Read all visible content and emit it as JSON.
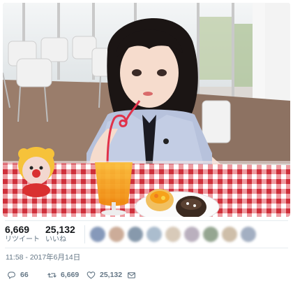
{
  "stats": {
    "retweets": {
      "count": "6,669",
      "label": "リツイート"
    },
    "likes": {
      "count": "25,132",
      "label": "いいね"
    }
  },
  "timestamp": "11:58 - 2017年6月14日",
  "actions": {
    "reply_count": "66",
    "retweet_count": "6,669",
    "like_count": "25,132"
  },
  "icons": [
    "reply-icon",
    "retweet-icon",
    "heart-icon",
    "mail-icon"
  ],
  "colors": {
    "secondary_text": "#657786",
    "divider": "#e6ecf0",
    "tablecloth_red": "#d9333d",
    "juice_orange": "#f6a21a"
  }
}
